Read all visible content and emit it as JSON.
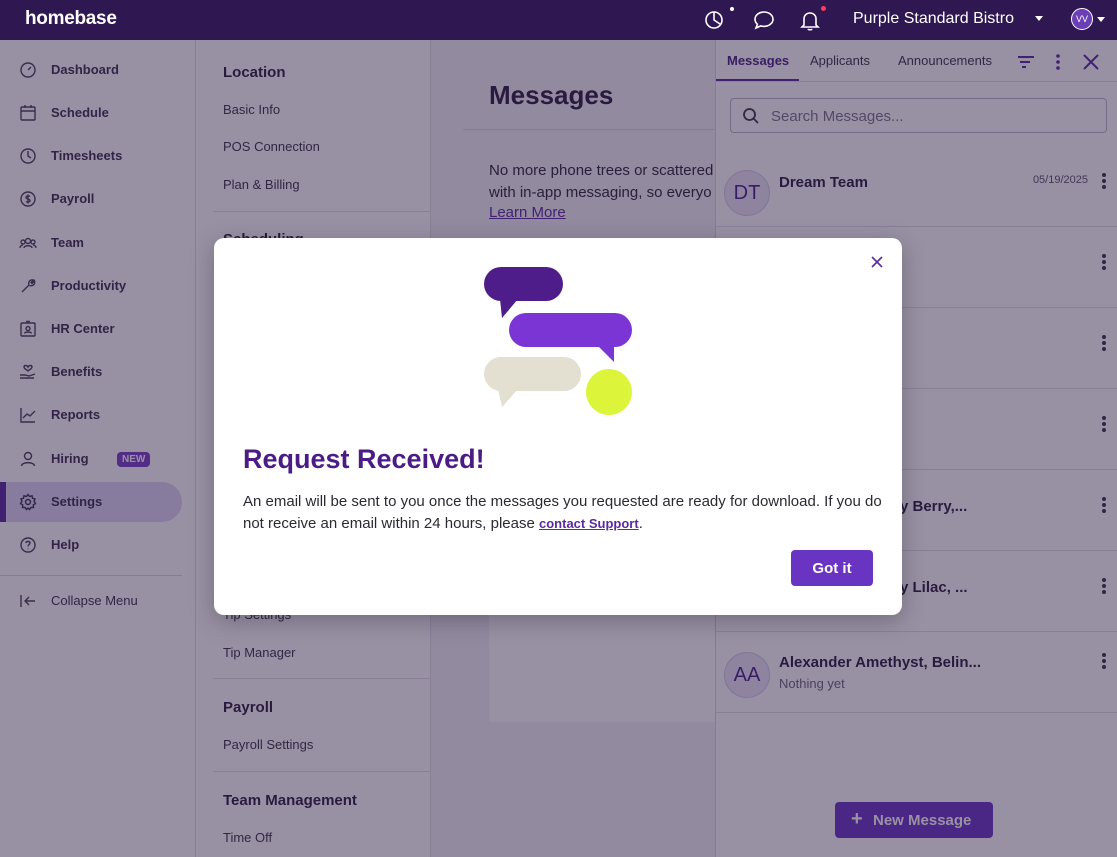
{
  "app": {
    "logo": "homebase",
    "location_name": "Purple Standard Bistro",
    "user_initials": "VV"
  },
  "sidebar": {
    "items": [
      {
        "label": "Dashboard",
        "icon": "dashboard-icon"
      },
      {
        "label": "Schedule",
        "icon": "calendar-icon"
      },
      {
        "label": "Timesheets",
        "icon": "clock-icon"
      },
      {
        "label": "Payroll",
        "icon": "dollar-icon"
      },
      {
        "label": "Team",
        "icon": "team-icon"
      },
      {
        "label": "Productivity",
        "icon": "wrench-icon"
      },
      {
        "label": "HR Center",
        "icon": "id-badge-icon"
      },
      {
        "label": "Benefits",
        "icon": "hand-heart-icon"
      },
      {
        "label": "Reports",
        "icon": "chart-icon"
      },
      {
        "label": "Hiring",
        "icon": "person-icon",
        "badge": "NEW"
      },
      {
        "label": "Settings",
        "icon": "gear-icon",
        "active": true
      },
      {
        "label": "Help",
        "icon": "help-icon"
      }
    ],
    "collapse_label": "Collapse Menu"
  },
  "settings_nav": {
    "location_heading": "Location",
    "location_links": [
      "Basic Info",
      "POS Connection",
      "Plan & Billing"
    ],
    "scheduling_heading": "Scheduling",
    "tip_links": [
      "Tip Settings",
      "Tip Manager"
    ],
    "payroll_heading": "Payroll",
    "payroll_links": [
      "Payroll Settings"
    ],
    "team_heading": "Team Management",
    "team_links": [
      "Time Off"
    ]
  },
  "main": {
    "title": "Messages",
    "text_line1": "No more phone trees or scattered",
    "text_line2": "with in-app messaging, so everyo",
    "learn_more": "Learn More"
  },
  "messages_panel": {
    "tabs": [
      {
        "label": "Messages",
        "active": true
      },
      {
        "label": "Applicants"
      },
      {
        "label": "Announcements"
      }
    ],
    "search_placeholder": "Search Messages...",
    "conversations": [
      {
        "initials": "DT",
        "name": "Dream Team",
        "date": "05/19/2025",
        "sub": ""
      },
      {
        "initials": "",
        "name": "",
        "date": "",
        "sub": ""
      },
      {
        "initials": "",
        "name": "",
        "date": "",
        "sub": ""
      },
      {
        "initials": "",
        "name": "",
        "date": "",
        "sub": ""
      },
      {
        "initials": "",
        "name": "y Berry,...",
        "date": "",
        "sub": ""
      },
      {
        "initials": "",
        "name": "y Lilac, ...",
        "date": "",
        "sub": ""
      },
      {
        "initials": "AA",
        "name": "Alexander Amethyst, Belin...",
        "date": "",
        "sub": "Nothing yet"
      }
    ],
    "new_message_label": "New Message"
  },
  "modal": {
    "title": "Request Received!",
    "body_text": "An email will be sent to you once the messages you requested are ready for download. If you do not receive an email within 24 hours, please ",
    "support_link": "contact Support",
    "body_end": ".",
    "button_label": "Got it"
  },
  "colors": {
    "topbar": "#2f1752",
    "accent": "#6a34c2",
    "title_purple": "#4b1c86",
    "bubble_dark": "#4e1d8a",
    "bubble_mid": "#7b35d4",
    "bubble_light": "#e3e0d2",
    "dot_lime": "#dcf53a"
  }
}
